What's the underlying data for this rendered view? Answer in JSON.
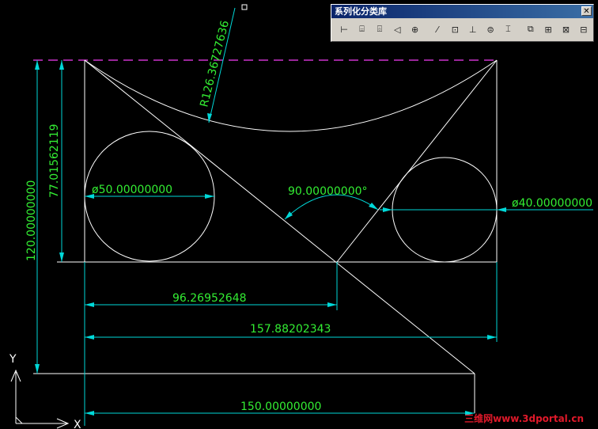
{
  "toolbar": {
    "title": "系列化分类库",
    "close_glyph": "✕",
    "tools": [
      {
        "name": "linear-dim-icon",
        "glyph": "⊢"
      },
      {
        "name": "aligned-dim-icon",
        "glyph": "⌸"
      },
      {
        "name": "ordinate-dim-icon",
        "glyph": "⌹"
      },
      {
        "name": "radius-dim-icon",
        "glyph": "◁"
      },
      {
        "name": "diameter-dim-icon",
        "glyph": "⊕"
      },
      {
        "name": "angular-dim-icon",
        "glyph": "⁄"
      },
      {
        "name": "quick-dim-icon",
        "glyph": "⊡"
      },
      {
        "name": "baseline-dim-icon",
        "glyph": "⊥"
      },
      {
        "name": "continue-dim-icon",
        "glyph": "⊜"
      },
      {
        "name": "leader-icon",
        "glyph": "⌶"
      },
      {
        "name": "tolerance-icon",
        "glyph": "⧉"
      },
      {
        "name": "center-mark-icon",
        "glyph": "⊞"
      },
      {
        "name": "dim-edit-icon",
        "glyph": "⊠"
      },
      {
        "name": "dim-style-icon",
        "glyph": "⊟"
      }
    ]
  },
  "dimensions": {
    "radius": "R126.36727636",
    "height_total": "120.00000000",
    "height_partial": "77.01562119",
    "dia_left": "ø50.00000000",
    "dia_right": "ø40.00000000",
    "angle": "90.00000000°",
    "width_96": "96.26952648",
    "width_157": "157.88202343",
    "width_150": "150.00000000"
  },
  "ucs": {
    "x_label": "X",
    "y_label": "Y"
  },
  "watermark": {
    "prefix": "三维网",
    "text": "www.3dportal.cn"
  },
  "colors": {
    "background": "#000000",
    "geometry": "#ffffff",
    "dimension_lines": "#00d8d8",
    "dimension_text": "#33ee33",
    "hidden_line": "#cc33cc",
    "watermark": "#e0192a"
  }
}
